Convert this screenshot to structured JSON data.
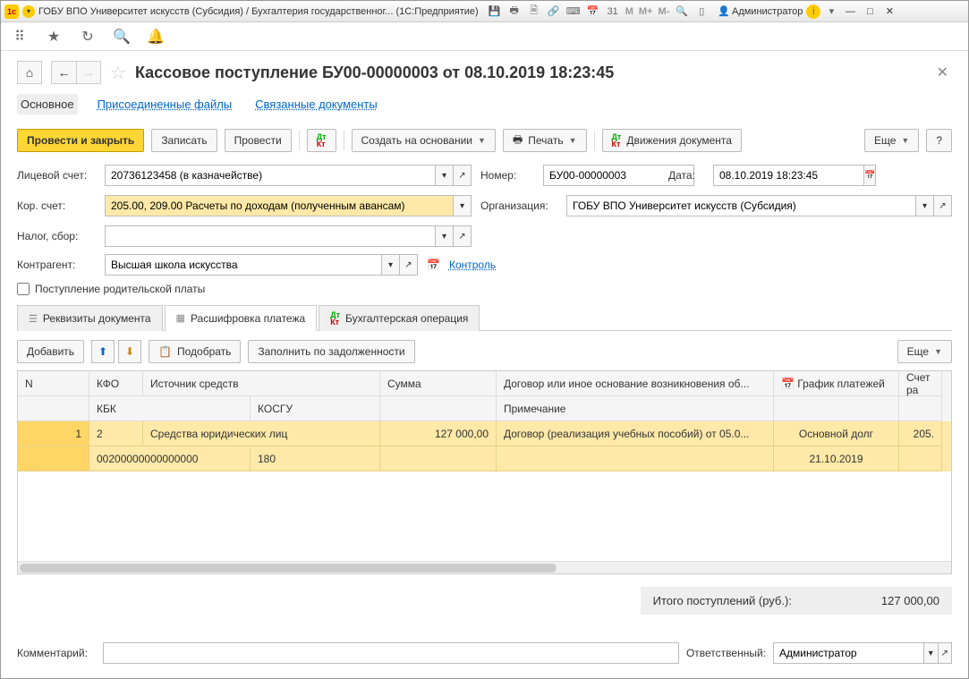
{
  "titlebar": {
    "title": "ГОБУ ВПО Университет искусств (Субсидия) / Бухгалтерия государственног...  (1С:Предприятие)",
    "user": "Администратор"
  },
  "doc": {
    "title": "Кассовое поступление БУ00-00000003 от 08.10.2019 18:23:45"
  },
  "subtabs": {
    "main": "Основное",
    "files": "Присоединенные файлы",
    "linked": "Связанные документы"
  },
  "cmd": {
    "post_close": "Провести и закрыть",
    "save": "Записать",
    "post": "Провести",
    "create_based": "Создать на основании",
    "print": "Печать",
    "movements": "Движения документа",
    "more": "Еще",
    "help": "?"
  },
  "form": {
    "account_lbl": "Лицевой счет:",
    "account_val": "20736123458 (в казначействе)",
    "number_lbl": "Номер:",
    "number_val": "БУ00-00000003",
    "date_lbl": "Дата:",
    "date_val": "08.10.2019 18:23:45",
    "corr_lbl": "Кор. счет:",
    "corr_val": "205.00, 209.00 Расчеты по доходам (полученным авансам)",
    "org_lbl": "Организация:",
    "org_val": "ГОБУ ВПО Университет искусств (Субсидия)",
    "tax_lbl": "Налог, сбор:",
    "tax_val": "",
    "contr_lbl": "Контрагент:",
    "contr_val": "Высшая школа искусства",
    "control": "Контроль",
    "parent_pay": "Поступление родительской платы"
  },
  "tabs": {
    "t1": "Реквизиты документа",
    "t2": "Расшифровка платежа",
    "t3": "Бухгалтерская операция"
  },
  "gridcmd": {
    "add": "Добавить",
    "pick": "Подобрать",
    "fill": "Заполнить по задолженности",
    "more": "Еще"
  },
  "gridhead": {
    "n": "N",
    "kfo": "КФО",
    "src": "Источник средств",
    "kbk": "КБК",
    "kosgu": "КОСГУ",
    "sum": "Сумма",
    "contract": "Договор или иное основание возникновения об...",
    "note": "Примечание",
    "schedule": "График платежей",
    "acct": "Счет ра"
  },
  "gridrow": {
    "n": "1",
    "kfo": "2",
    "src": "Средства юридических лиц",
    "kbk": "00200000000000000",
    "kosgu": "180",
    "sum": "127 000,00",
    "contract": "Договор (реализация учебных пособий) от 05.0...",
    "schedule1": "Основной долг",
    "schedule2": "21.10.2019",
    "acct": "205."
  },
  "total": {
    "label": "Итого поступлений (руб.):",
    "value": "127 000,00"
  },
  "footer": {
    "comment_lbl": "Комментарий:",
    "comment_val": "",
    "resp_lbl": "Ответственный:",
    "resp_val": "Администратор"
  }
}
